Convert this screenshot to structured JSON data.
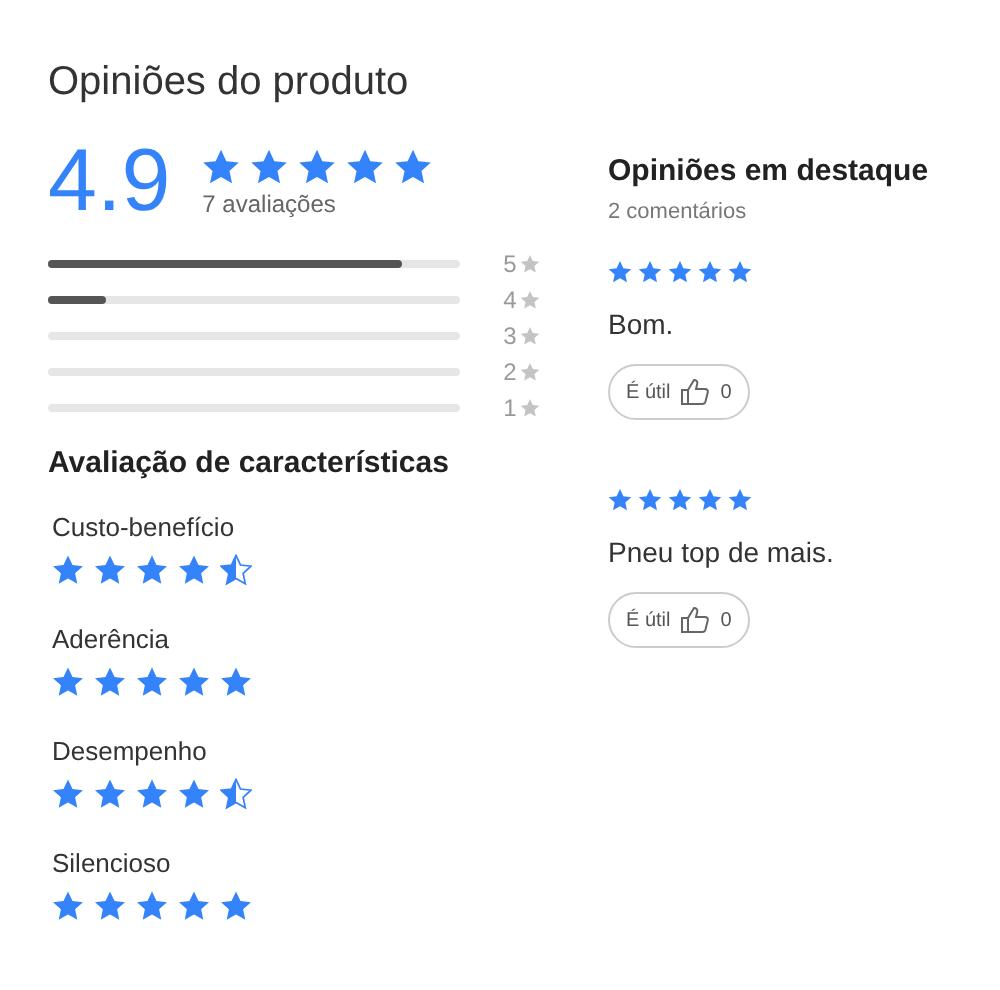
{
  "title": "Opiniões do produto",
  "summary": {
    "score": "4.9",
    "stars": 5,
    "count": "7 avaliações"
  },
  "distribution": [
    {
      "label": "5",
      "level": 0.86
    },
    {
      "label": "4",
      "level": 0.14
    },
    {
      "label": "3"
    },
    {
      "label": "2"
    },
    {
      "label": "1"
    }
  ],
  "characteristics": {
    "title": "Avaliação de características",
    "items": [
      {
        "name": "Custo-benefício",
        "stars": 4.5
      },
      {
        "name": "Aderência",
        "stars": 5
      },
      {
        "name": "Desempenho",
        "stars": 4.5
      },
      {
        "name": "Silencioso",
        "stars": 5
      }
    ]
  },
  "featured": {
    "title": "Opiniões em destaque",
    "count": "2 comentários",
    "reviews": [
      {
        "stars": 5,
        "text": "Bom.",
        "helpful": "É útil",
        "likes": "0"
      },
      {
        "stars": 5,
        "text": "Pneu top de mais.",
        "helpful": "É útil",
        "likes": "0"
      }
    ]
  }
}
